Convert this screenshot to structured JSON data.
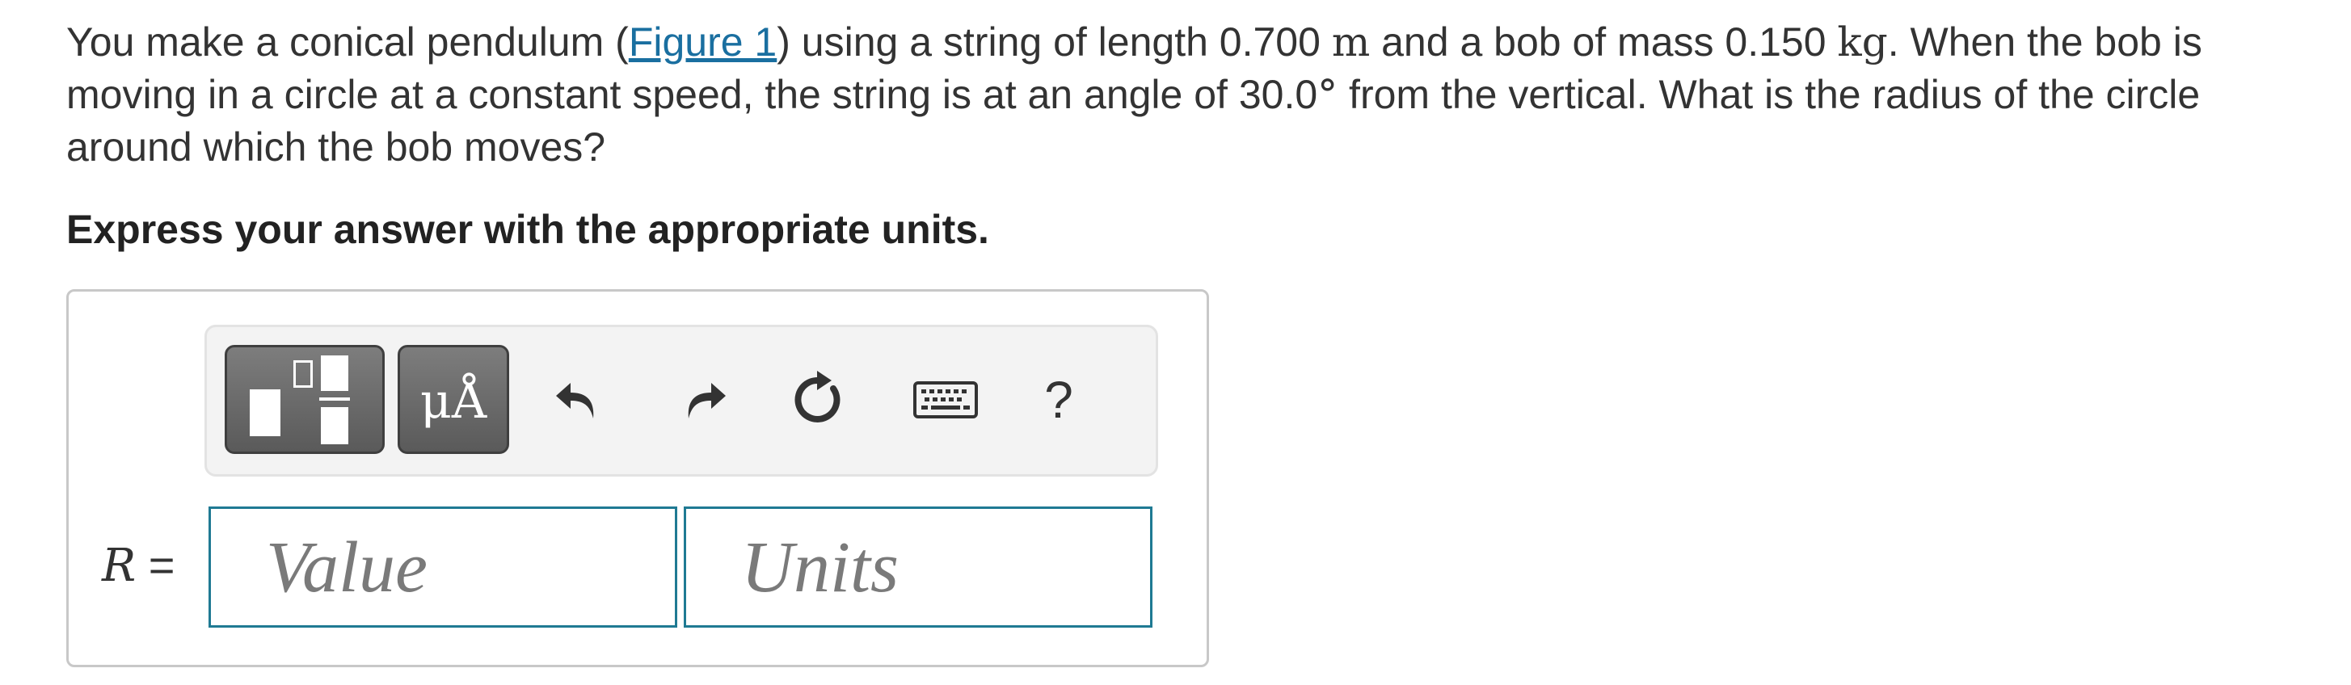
{
  "question": {
    "part1": "You make a conical pendulum (",
    "figure_link": "Figure 1",
    "part2": ") using a string of length 0.700 ",
    "length_unit": "m",
    "part3": " and a bob of mass 0.150 ",
    "mass_unit": "kg",
    "part4": ". When the bob is moving in a circle at a constant speed, the string is at an angle of 30.0",
    "degree_symbol": "°",
    "part5": " from the vertical. What is the radius of the circle around which the bob moves?"
  },
  "instruction": "Express your answer with the appropriate units.",
  "toolbar": {
    "units_label": "μÅ",
    "help_label": "?",
    "icons": [
      "templates-icon",
      "units-icon",
      "undo-icon",
      "redo-icon",
      "reset-icon",
      "keyboard-icon",
      "help-icon"
    ]
  },
  "answer": {
    "variable": "R",
    "equals": " =",
    "value_placeholder": "Value",
    "units_placeholder": "Units"
  },
  "colors": {
    "link": "#1a6fa0",
    "input_border": "#1f7a93",
    "button_dark": "#666666"
  }
}
